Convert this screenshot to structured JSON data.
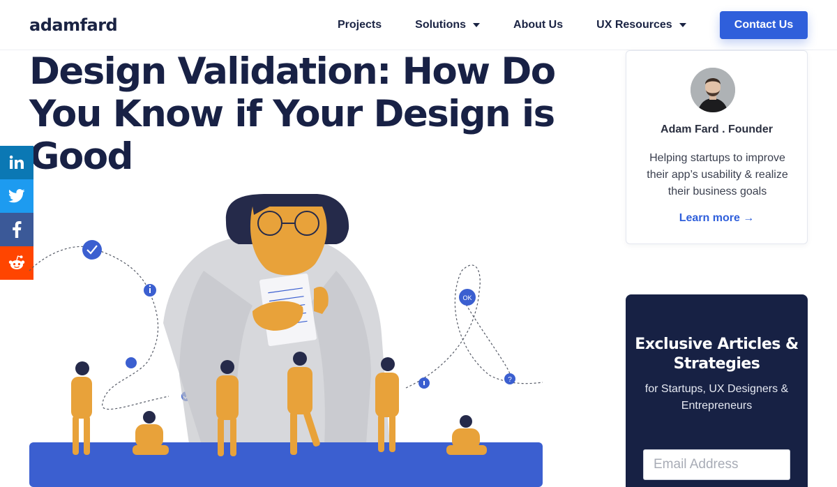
{
  "header": {
    "logo": "adamfard",
    "nav": [
      {
        "label": "Projects"
      },
      {
        "label": "Solutions"
      },
      {
        "label": "About Us"
      },
      {
        "label": "UX Resources"
      }
    ],
    "contact_label": "Contact Us"
  },
  "article": {
    "title": "Design Validation: How Do You Know if Your Design is Good"
  },
  "social": [
    {
      "network": "linkedin",
      "icon": "linkedin-icon",
      "color": "#0b78b4"
    },
    {
      "network": "twitter",
      "icon": "twitter-icon",
      "color": "#1d9bf0"
    },
    {
      "network": "facebook",
      "icon": "facebook-icon",
      "color": "#3b5998"
    },
    {
      "network": "reddit",
      "icon": "reddit-icon",
      "color": "#ff4500"
    }
  ],
  "author_card": {
    "name": "Adam Fard . Founder",
    "description": "Helping startups to improve their app’s usability & realize their business goals",
    "link_label": "Learn more →"
  },
  "newsletter": {
    "title": "Exclusive Articles & Strategies",
    "subtitle": "for Startups, UX Designers & Entrepreneurs",
    "email_placeholder": "Email Address"
  },
  "colors": {
    "navy": "#172144",
    "accent": "#2f5fdb",
    "illustration_orange": "#e8a23a",
    "illustration_blue": "#3b5fd0"
  }
}
